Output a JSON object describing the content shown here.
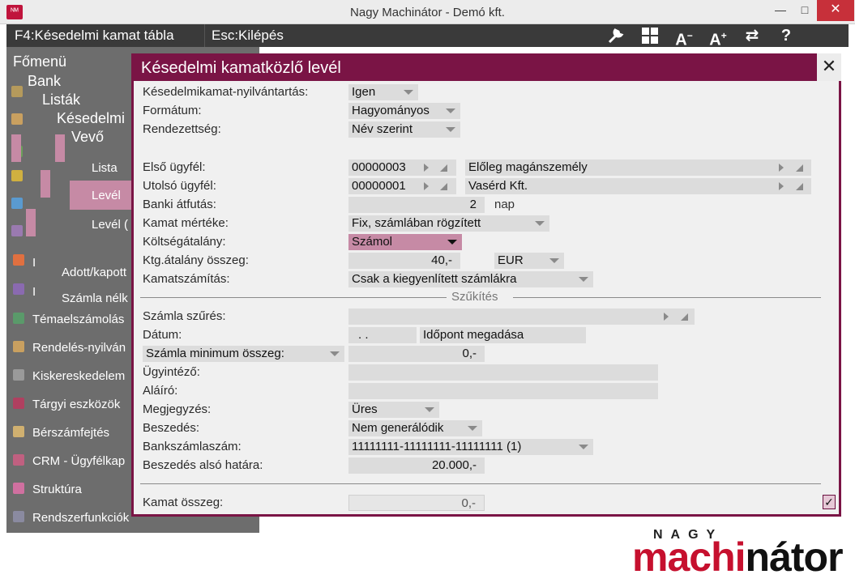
{
  "window": {
    "title": "Nagy Machinátor - Demó kft.",
    "app_icon": "ᴺᴹ"
  },
  "toolbar": {
    "f4_label": "F4:Késedelmi kamat tábla",
    "esc_label": "Esc:Kilépés",
    "icons": [
      "wrench-icon",
      "grid-icon",
      "font-decrease-icon",
      "font-increase-icon",
      "swap-icon",
      "help-icon"
    ]
  },
  "menu": {
    "fomenu": "Főmenü",
    "bank": "Bank",
    "listak": "Listák",
    "kesedelmi": "Késedelmi",
    "vevo": "Vevő",
    "lista": "Lista",
    "level": "Levél",
    "level2": "Levél (",
    "i1": "I",
    "adott": "Adott/kapott",
    "i2": "I",
    "szamla": "Számla nélk",
    "items": [
      "Témaelszámolás",
      "Rendelés-nyilván",
      "Kiskereskedelem",
      "Tárgyi eszközök",
      "Bérszámfejtés",
      "CRM - Ügyfélkap",
      "Struktúra",
      "Rendszerfunkciók"
    ]
  },
  "dialog": {
    "title": "Késedelmi kamatközlő levél",
    "close": "✕",
    "fields": {
      "nyilvantartas": {
        "label": "Késedelmikamat-nyilvántartás:",
        "value": "Igen"
      },
      "formatum": {
        "label": "Formátum:",
        "value": "Hagyományos"
      },
      "rendezettseg": {
        "label": "Rendezettség:",
        "value": "Név szerint"
      },
      "elso": {
        "label": "Első ügyfél:",
        "code": "00000003",
        "name": "Előleg magánszemély"
      },
      "utolso": {
        "label": "Utolsó ügyfél:",
        "code": "00000001",
        "name": "Vasérd Kft."
      },
      "atfutas": {
        "label": "Banki átfutás:",
        "value": "2",
        "unit": "nap"
      },
      "kamat_mertek": {
        "label": "Kamat mértéke:",
        "value": "Fix, számlában rögzített"
      },
      "koltseg": {
        "label": "Költségátalány:",
        "value": "Számol"
      },
      "ktg_osszeg": {
        "label": "Ktg.átalány összeg:",
        "value": "40,-",
        "currency": "EUR"
      },
      "kamatszamitas": {
        "label": "Kamatszámítás:",
        "value": "Csak a kiegyenlített számlákra"
      },
      "szukites": "Szűkítés",
      "szamla_szures": {
        "label": "Számla szűrés:",
        "value": ""
      },
      "datum": {
        "label": "Dátum:",
        "value": ". .",
        "button": "Időpont megadása"
      },
      "min_osszeg": {
        "label": "Számla minimum összeg:",
        "value": "0,-"
      },
      "ugyintezo": {
        "label": "Ügyintéző:",
        "value": ""
      },
      "alairo": {
        "label": "Aláíró:",
        "value": ""
      },
      "megjegyzes": {
        "label": "Megjegyzés:",
        "value": "Üres"
      },
      "beszedes": {
        "label": "Beszedés:",
        "value": "Nem generálódik"
      },
      "bankszamla": {
        "label": "Bankszámlaszám:",
        "value": "11111111-11111111-11111111 (1)"
      },
      "beszedes_hatar": {
        "label": "Beszedés alsó határa:",
        "value": "20.000,-"
      },
      "kamat_osszeg": {
        "label": "Kamat összeg:",
        "value": "0,-"
      }
    },
    "ok_check": "✓"
  },
  "logo": {
    "top": "NAGY",
    "mach": "mach",
    "i": "i",
    "nator": "nátor"
  },
  "colors": {
    "accent": "#7a1445",
    "highlight": "#c68aa5",
    "menu_bg": "#6d6d6d",
    "brand_red": "#c6102e"
  }
}
